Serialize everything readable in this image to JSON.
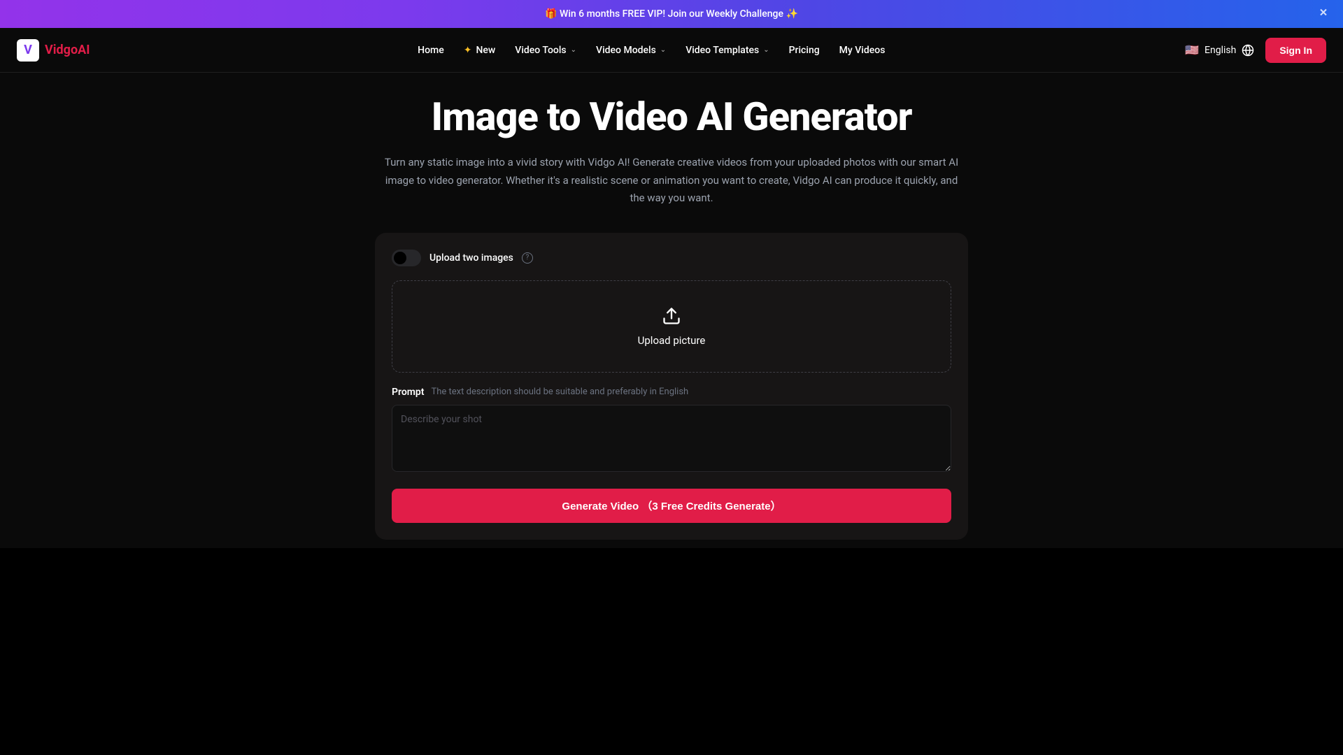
{
  "banner": {
    "text": "🎁 Win 6 months FREE VIP! Join our Weekly Challenge ✨"
  },
  "logo": {
    "icon": "V",
    "text": "VidgoAI"
  },
  "nav": {
    "home": "Home",
    "new": "New",
    "video_tools": "Video Tools",
    "video_models": "Video Models",
    "video_templates": "Video Templates",
    "pricing": "Pricing",
    "my_videos": "My Videos"
  },
  "lang": {
    "label": "English",
    "flag": "🇺🇸"
  },
  "signin": "Sign In",
  "hero": {
    "title": "Image to Video AI Generator",
    "desc": "Turn any static image into a vivid story with Vidgo AI! Generate creative videos from your uploaded photos with our smart AI image to video generator. Whether it's a realistic scene or animation you want to create, Vidgo AI can produce it quickly, and the way you want."
  },
  "form": {
    "toggle_label": "Upload two images",
    "upload_text": "Upload picture",
    "prompt_label": "Prompt",
    "prompt_hint": "The text description should be suitable and preferably in English",
    "prompt_placeholder": "Describe your shot",
    "generate_btn": "Generate Video （3 Free Credits Generate）"
  }
}
